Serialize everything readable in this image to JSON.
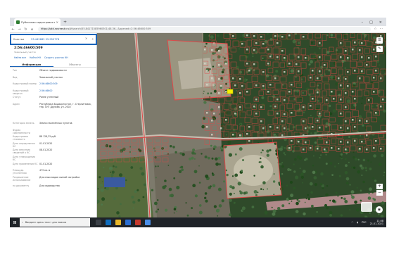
{
  "browser": {
    "tab_title": "Публичная кадастровая карта",
    "tab_close": "×",
    "new_tab": "+",
    "window_controls": [
      "–",
      "□",
      "×"
    ],
    "nav": [
      "←",
      "→",
      "↻",
      "⌂"
    ],
    "url_host": "https://pkk.rosreestr.ru",
    "url_path": "/#/search/55.84171585960301/48.36...&opened=2:56:46600:509",
    "toolbar_icons": [
      "star-icon",
      "menu-icon"
    ]
  },
  "search": {
    "type_label": "Участки",
    "value": "53.442682 55.959778",
    "clear_icon": "×",
    "search_icon": "⌕"
  },
  "parcel": {
    "cadastral_number": "2:56:46600:509",
    "subtitle": "Земельный участок",
    "actions": [
      "Найти все",
      "Найти КН",
      "Создать участок КН"
    ],
    "tabs": [
      "Информация",
      "Объекты"
    ],
    "rows": [
      {
        "key": "Тип",
        "value": "Объект недвижимости",
        "link": false
      },
      {
        "key": "Вид",
        "value": "Земельный участок",
        "link": false
      },
      {
        "key": "Кадастровый номер",
        "value": "2:56:46600:509",
        "link": true
      },
      {
        "key": "Кадастровый квартал",
        "value": "2:56:46600",
        "link": true
      },
      {
        "key": "Статус",
        "value": "Ранее учтенный",
        "link": false
      },
      {
        "key": "Адрес",
        "value": "Республика Башкортостан, г. Стерлитамак, тер. СНТ Дружба, ул. 2002",
        "link": false
      },
      {
        "key": "Категория земель",
        "value": "Земли населённых пунктов",
        "link": false
      },
      {
        "key": "Форма собственности",
        "value": "",
        "link": false
      },
      {
        "key": "Кадастровая стоимость",
        "value": "88 128,25 руб.",
        "link": false
      },
      {
        "key": "Дата определения КС",
        "value": "01.01.2020",
        "link": false
      },
      {
        "key": "Дата внесения сведений о КС",
        "value": "08.01.2020",
        "link": false
      },
      {
        "key": "Дата утверждения КС",
        "value": "",
        "link": false
      },
      {
        "key": "Дата применения КС",
        "value": "01.01.2020",
        "link": false
      },
      {
        "key": "Площадь уточненная",
        "value": "473 кв. м",
        "link": false
      },
      {
        "key": "Разрешенное использование",
        "value": "Для иных видов жилой застройки",
        "link": false
      },
      {
        "key": "по документу",
        "value": "Для садоводства",
        "link": false
      }
    ]
  },
  "map": {
    "tools": [
      "☰",
      "✎"
    ],
    "zoom_in": "+",
    "zoom_out": "−",
    "compass": "◉"
  },
  "taskbar": {
    "start_icon": "⊞",
    "search_placeholder": "Введите здесь текст для поиска",
    "time": "11:08",
    "date": "21.01.2021",
    "lang": "РУС"
  },
  "colors": {
    "accent": "#1a63b8",
    "parcel_outline": "#e04848",
    "highlight": "#f4f000",
    "taskbar": "#1f2328"
  }
}
